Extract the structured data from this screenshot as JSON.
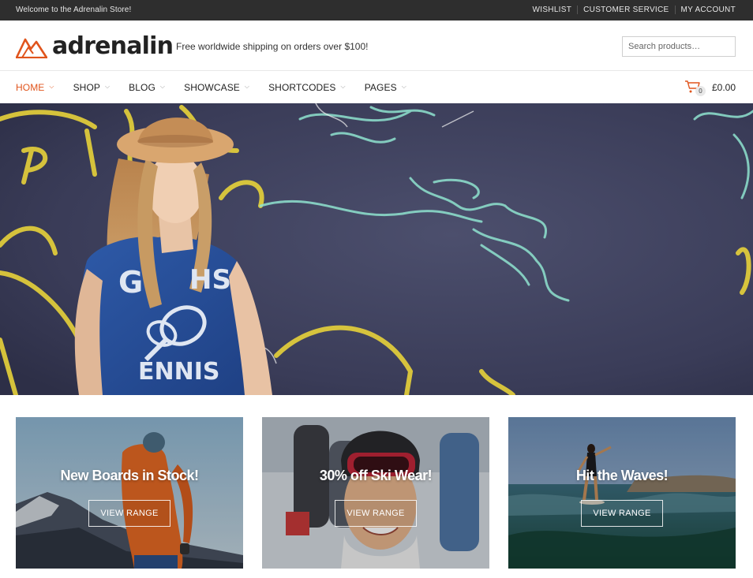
{
  "topbar": {
    "welcome": "Welcome to the Adrenalin Store!",
    "links": [
      "WISHLIST",
      "CUSTOMER SERVICE",
      "MY ACCOUNT"
    ]
  },
  "header": {
    "logo_text": "adrenalin",
    "tagline": "Free worldwide shipping on orders over $100!",
    "search_placeholder": "Search products…"
  },
  "nav": {
    "items": [
      {
        "label": "HOME",
        "active": true
      },
      {
        "label": "SHOP"
      },
      {
        "label": "BLOG"
      },
      {
        "label": "SHOWCASE"
      },
      {
        "label": "SHORTCODES"
      },
      {
        "label": "PAGES"
      }
    ],
    "cart_count": "0",
    "cart_total": "£0.00"
  },
  "promos": [
    {
      "title": "New Boards in Stock!",
      "button": "VIEW RANGE"
    },
    {
      "title": "30% off Ski Wear!",
      "button": "VIEW RANGE"
    },
    {
      "title": "Hit the Waves!",
      "button": "VIEW RANGE"
    }
  ],
  "colors": {
    "accent": "#e0541c",
    "topbar_bg": "#2e2e2e"
  }
}
